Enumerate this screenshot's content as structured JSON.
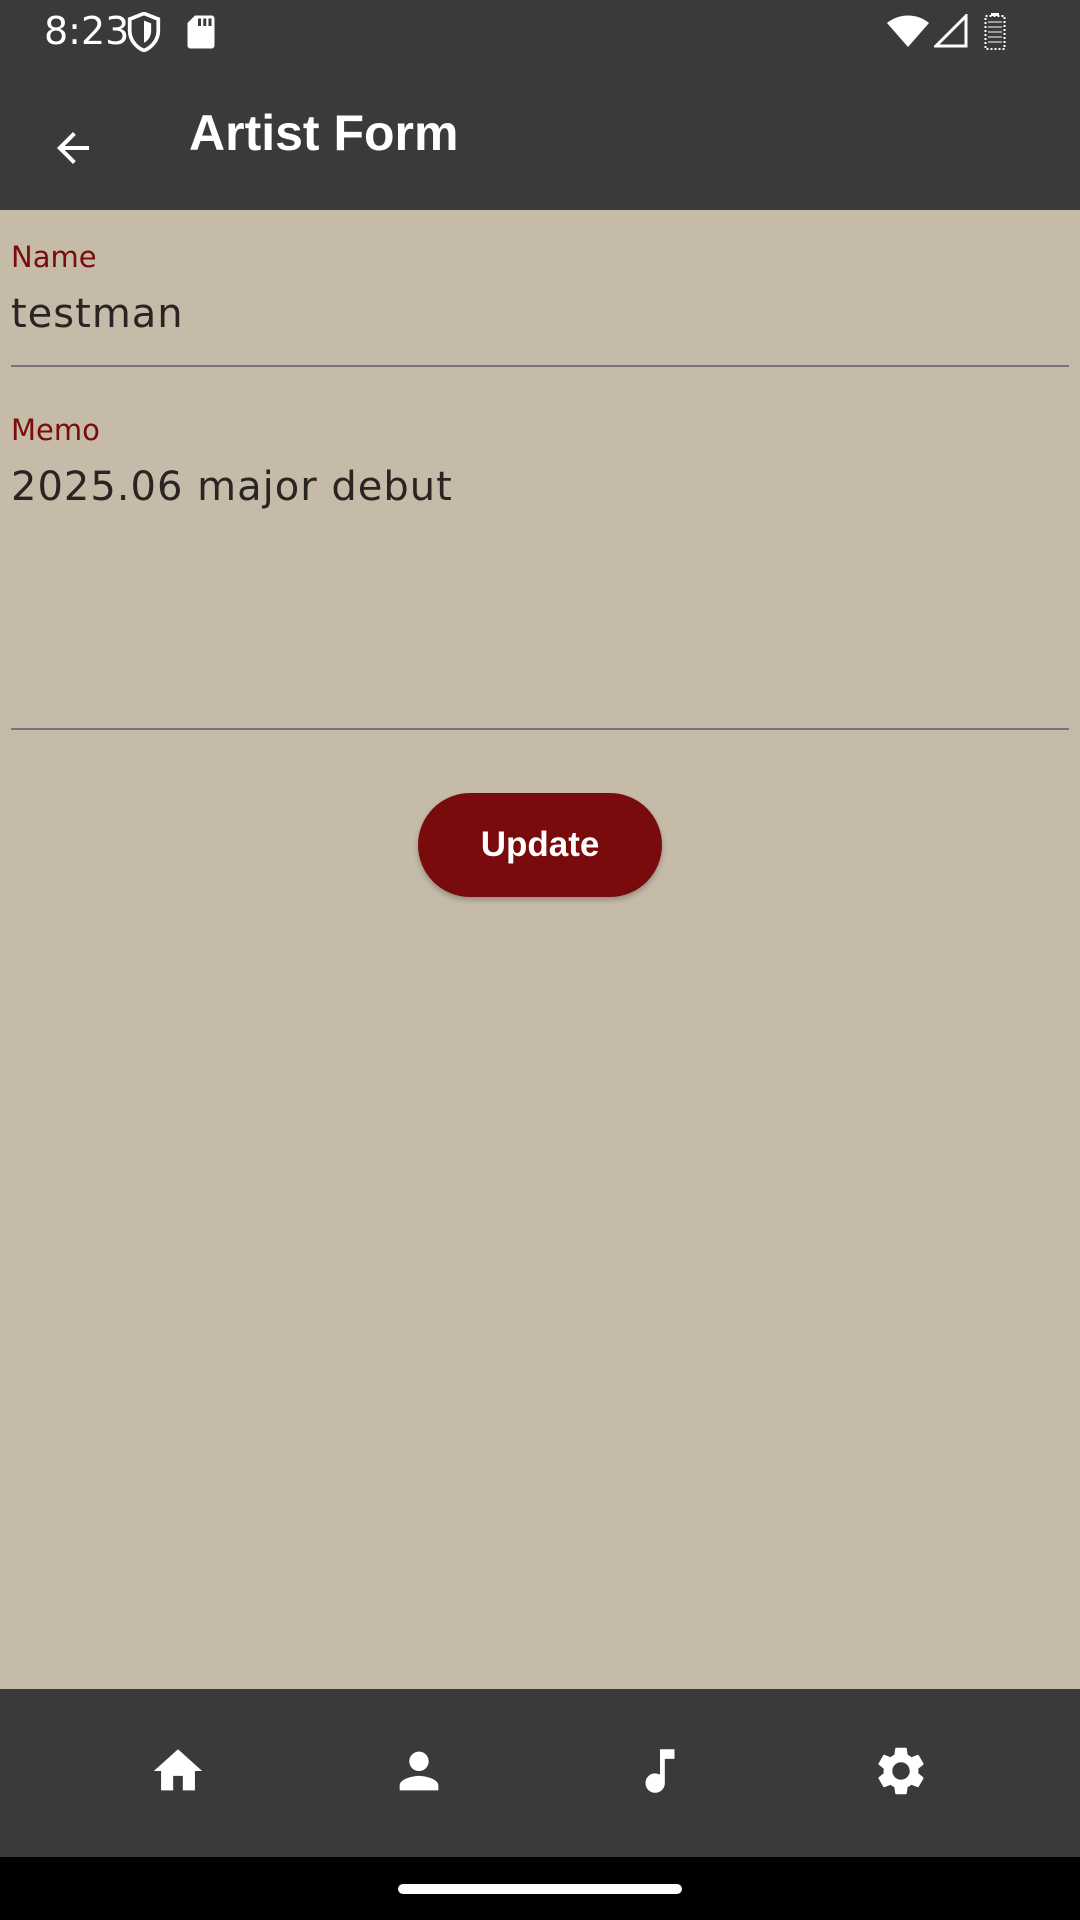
{
  "status_bar": {
    "time": "8:23",
    "icons": [
      "shield-icon",
      "sd-card-icon",
      "wifi-icon",
      "cell-signal-icon",
      "battery-icon"
    ]
  },
  "app_bar": {
    "title": "Artist Form",
    "back_icon": "arrow-back-icon"
  },
  "form": {
    "name": {
      "label": "Name",
      "value": "testman"
    },
    "memo": {
      "label": "Memo",
      "value": "2025.06 major debut"
    },
    "update_label": "Update"
  },
  "bottom_nav": {
    "items": [
      {
        "icon": "home-icon"
      },
      {
        "icon": "person-icon"
      },
      {
        "icon": "music-note-icon"
      },
      {
        "icon": "gear-icon"
      }
    ]
  },
  "colors": {
    "background": "#C6BBA9",
    "bar": "#3A3A3A",
    "accent": "#790B0C",
    "label": "#7A0C0C",
    "underline": "#77737A"
  }
}
